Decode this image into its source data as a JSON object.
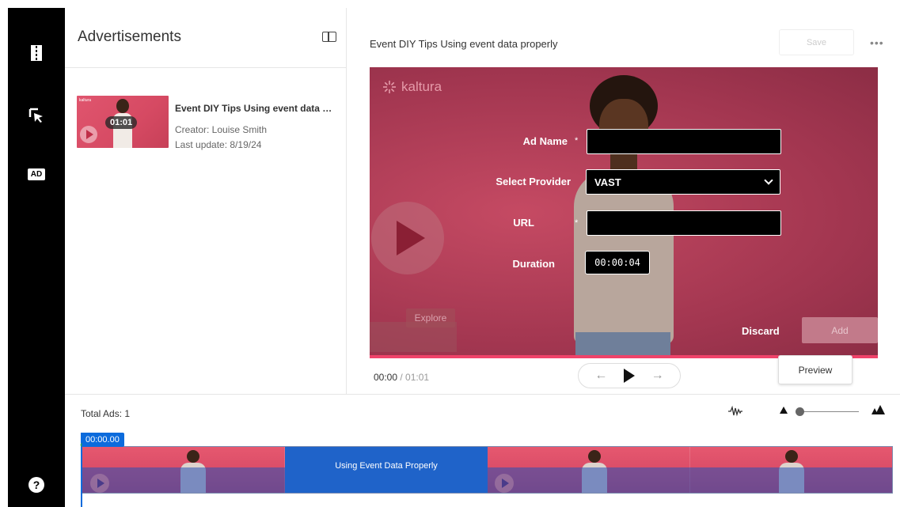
{
  "rail": {
    "ad_badge": "AD",
    "help": "?"
  },
  "list": {
    "title": "Advertisements",
    "entry": {
      "title": "Event DIY Tips Using event data properly",
      "duration": "01:01",
      "creator": "Creator: Louise Smith",
      "last_update": "Last update: 8/19/24"
    }
  },
  "editor": {
    "title": "Event DIY Tips Using event data properly",
    "save_label": "Save",
    "more": "•••",
    "logo_text": "kaltura",
    "explore_label": "Explore",
    "form": {
      "ad_name_label": "Ad Name",
      "ad_name_value": "",
      "provider_label": "Select Provider",
      "provider_value": "VAST",
      "url_label": "URL",
      "url_value": "",
      "duration_label": "Duration",
      "duration_value": "00:00:04",
      "required_mark": "*"
    },
    "discard_label": "Discard",
    "add_label": "Add",
    "time_current": "00:00",
    "time_total": "01:01",
    "preview_label": "Preview",
    "prev_arrow": "←",
    "next_arrow": "→"
  },
  "timeline": {
    "total_ads": "Total Ads: 1",
    "timecode": "00:00.00",
    "ad_block_label": "Using Event Data Properly"
  }
}
